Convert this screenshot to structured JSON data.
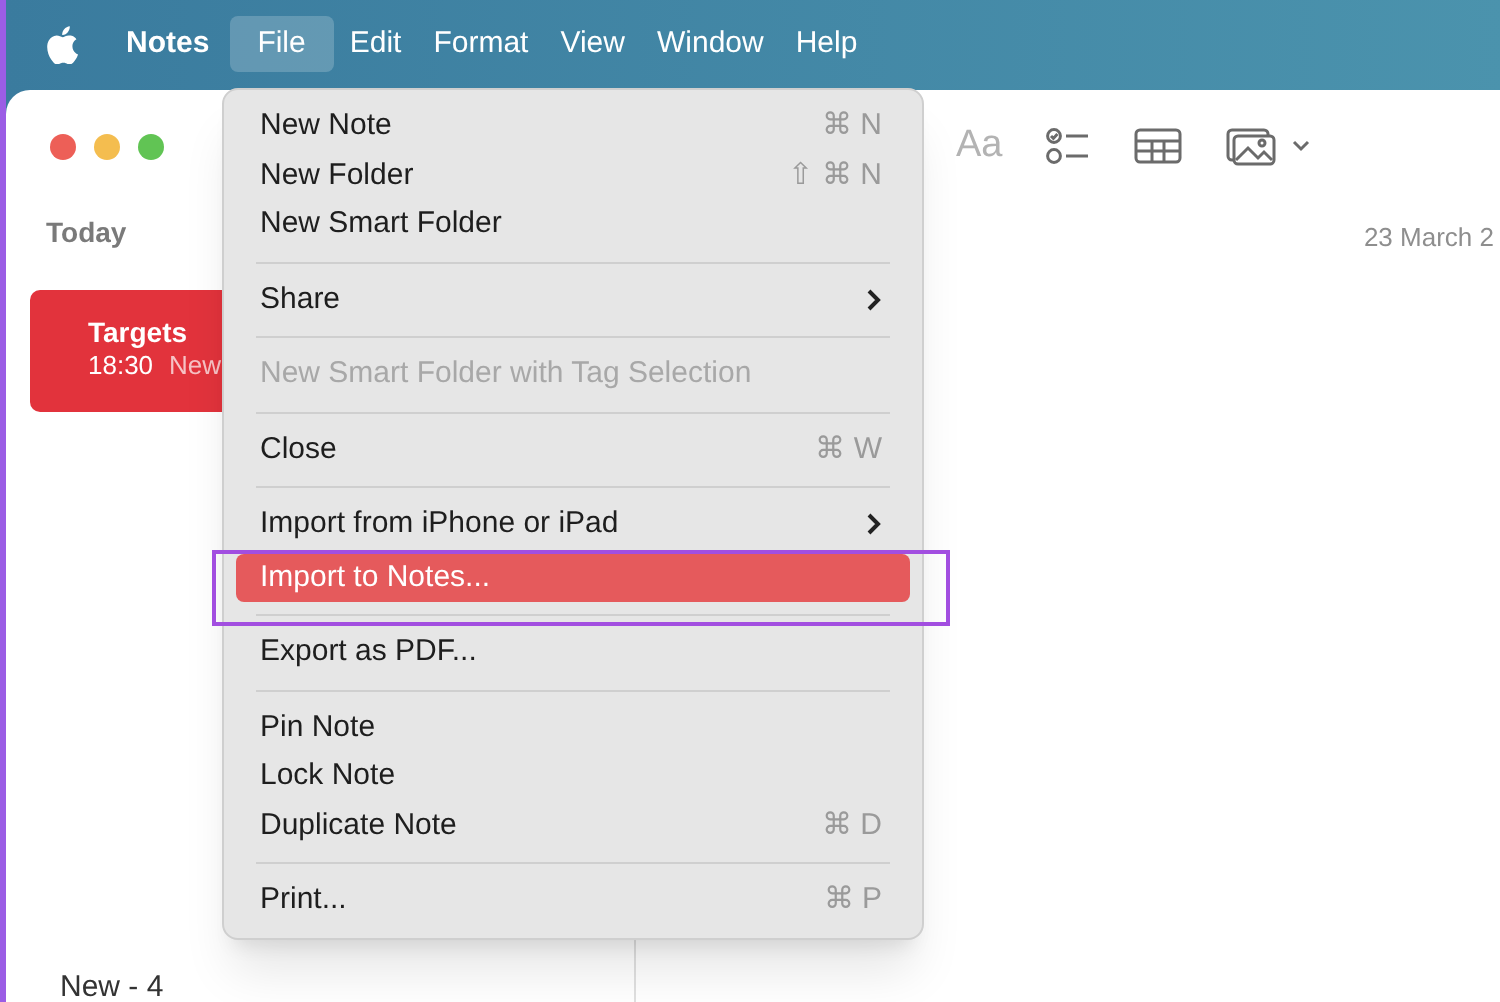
{
  "menu_bar": {
    "app_name": "Notes",
    "menus": [
      {
        "label": "File",
        "selected": true
      },
      {
        "label": "Edit",
        "selected": false
      },
      {
        "label": "Format",
        "selected": false
      },
      {
        "label": "View",
        "selected": false
      },
      {
        "label": "Window",
        "selected": false
      },
      {
        "label": "Help",
        "selected": false
      }
    ]
  },
  "toolbar": {
    "font_button": "Aa"
  },
  "sidebar": {
    "section": "Today",
    "notes": [
      {
        "title": "Targets",
        "time": "18:30",
        "preview": "New",
        "selected": true
      }
    ]
  },
  "note_list": {
    "items": [
      "New - 4"
    ]
  },
  "editor": {
    "date": "23 March 2"
  },
  "file_menu": {
    "items": [
      {
        "kind": "item",
        "label": "New Note",
        "shortcut": "⌘ N",
        "submenu": false,
        "disabled": false,
        "selected": false
      },
      {
        "kind": "item",
        "label": "New Folder",
        "shortcut": "⇧ ⌘ N",
        "submenu": false,
        "disabled": false,
        "selected": false
      },
      {
        "kind": "item",
        "label": "New Smart Folder",
        "submenu": false,
        "disabled": false,
        "selected": false
      },
      {
        "kind": "separator"
      },
      {
        "kind": "item",
        "label": "Share",
        "submenu": true,
        "disabled": false,
        "selected": false
      },
      {
        "kind": "separator"
      },
      {
        "kind": "item",
        "label": "New Smart Folder with Tag Selection",
        "submenu": false,
        "disabled": true,
        "selected": false
      },
      {
        "kind": "separator"
      },
      {
        "kind": "item",
        "label": "Close",
        "shortcut": "⌘ W",
        "submenu": false,
        "disabled": false,
        "selected": false
      },
      {
        "kind": "separator"
      },
      {
        "kind": "item",
        "label": "Import from iPhone or iPad",
        "submenu": true,
        "disabled": false,
        "selected": false
      },
      {
        "kind": "item",
        "label": "Import to Notes...",
        "submenu": false,
        "disabled": false,
        "selected": true,
        "highlighted": true
      },
      {
        "kind": "separator"
      },
      {
        "kind": "item",
        "label": "Export as PDF...",
        "submenu": false,
        "disabled": false,
        "selected": false
      },
      {
        "kind": "separator"
      },
      {
        "kind": "item",
        "label": "Pin Note",
        "submenu": false,
        "disabled": false,
        "selected": false
      },
      {
        "kind": "item",
        "label": "Lock Note",
        "submenu": false,
        "disabled": false,
        "selected": false
      },
      {
        "kind": "item",
        "label": "Duplicate Note",
        "shortcut": "⌘ D",
        "submenu": false,
        "disabled": false,
        "selected": false
      },
      {
        "kind": "separator"
      },
      {
        "kind": "item",
        "label": "Print...",
        "shortcut": "⌘ P",
        "submenu": false,
        "disabled": false,
        "selected": false
      }
    ]
  }
}
